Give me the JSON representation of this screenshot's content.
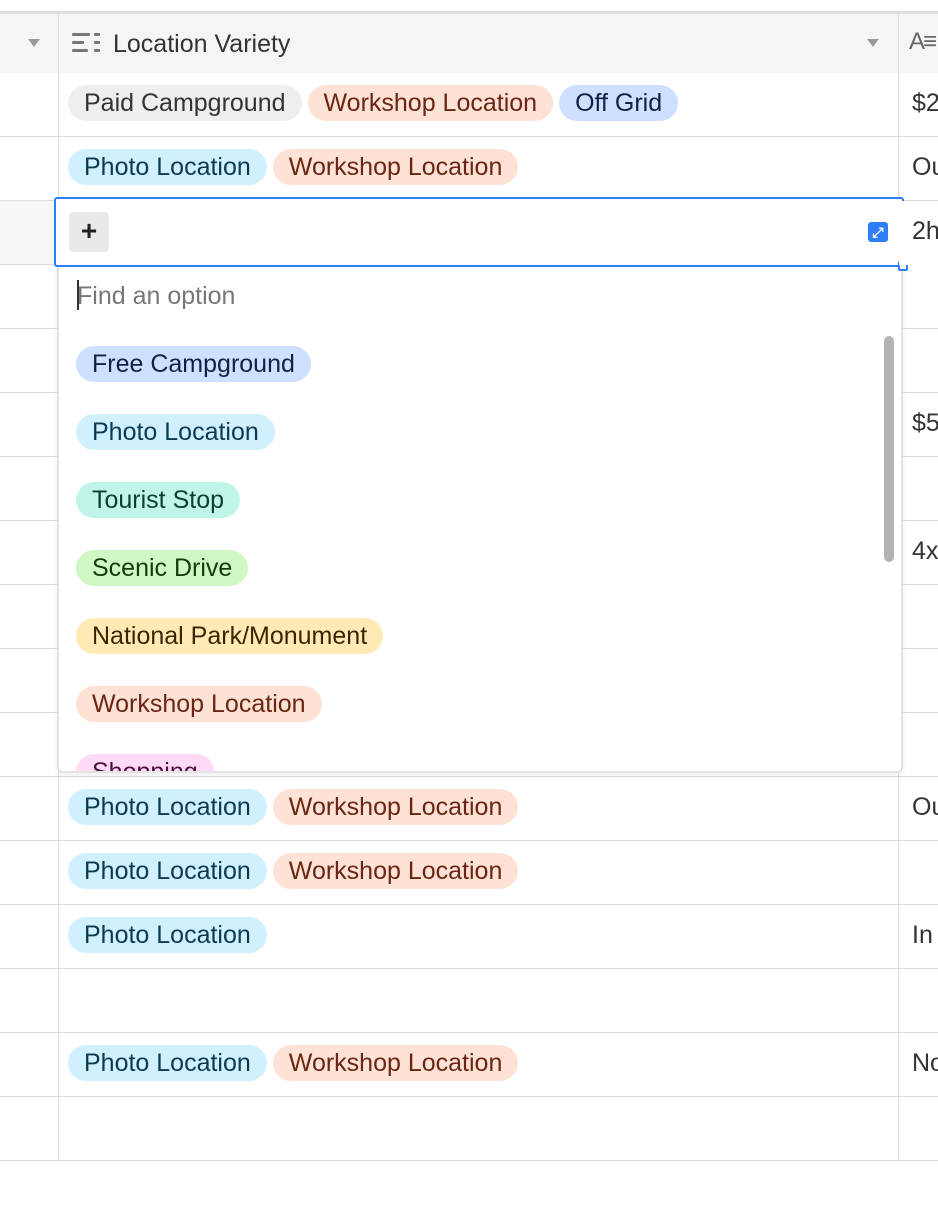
{
  "header": {
    "field_title": "Location Variety",
    "field_icon": "multi-select-field-icon",
    "right_field_icon": "long-text-field-icon"
  },
  "rows_top": [
    {
      "tags": [
        {
          "label": "Paid Campground",
          "color": "gray"
        },
        {
          "label": "Workshop Location",
          "color": "orange"
        },
        {
          "label": "Off Grid",
          "color": "blue"
        }
      ],
      "right": "$2"
    },
    {
      "tags": [
        {
          "label": "Photo Location",
          "color": "cyan"
        },
        {
          "label": "Workshop Location",
          "color": "orange"
        }
      ],
      "right": "Ou"
    }
  ],
  "active_row": {
    "right": "2h"
  },
  "background_right_values": {
    "row5": "$5",
    "row7": "4x"
  },
  "dropdown": {
    "search_placeholder": "Find an option",
    "options": [
      {
        "label": "Free Campground",
        "color": "blue"
      },
      {
        "label": "Photo Location",
        "color": "cyan"
      },
      {
        "label": "Tourist Stop",
        "color": "teal"
      },
      {
        "label": "Scenic Drive",
        "color": "green"
      },
      {
        "label": "National Park/Monument",
        "color": "yellow"
      },
      {
        "label": "Workshop Location",
        "color": "orange"
      },
      {
        "label": "Shopping",
        "color": "pink"
      }
    ]
  },
  "rows_bottom": [
    {
      "tags": [
        {
          "label": "Photo Location",
          "color": "cyan"
        },
        {
          "label": "Workshop Location",
          "color": "orange"
        }
      ],
      "right": "Ou"
    },
    {
      "tags": [
        {
          "label": "Photo Location",
          "color": "cyan"
        },
        {
          "label": "Workshop Location",
          "color": "orange"
        }
      ],
      "right": ""
    },
    {
      "tags": [
        {
          "label": "Photo Location",
          "color": "cyan"
        }
      ],
      "right": "In"
    },
    {
      "tags": [],
      "right": ""
    },
    {
      "tags": [
        {
          "label": "Photo Location",
          "color": "cyan"
        },
        {
          "label": "Workshop Location",
          "color": "orange"
        }
      ],
      "right": "No"
    },
    {
      "tags": [],
      "right": ""
    }
  ],
  "colors": {
    "accent": "#2d7ff9",
    "gray": "#eeeeee",
    "orange": "#fee2d5",
    "blue": "#cfdfff",
    "cyan": "#d0f0fd",
    "teal": "#c2f5e9",
    "green": "#d1f7c4",
    "yellow": "#ffeab6",
    "pink": "#ffdaf6"
  }
}
